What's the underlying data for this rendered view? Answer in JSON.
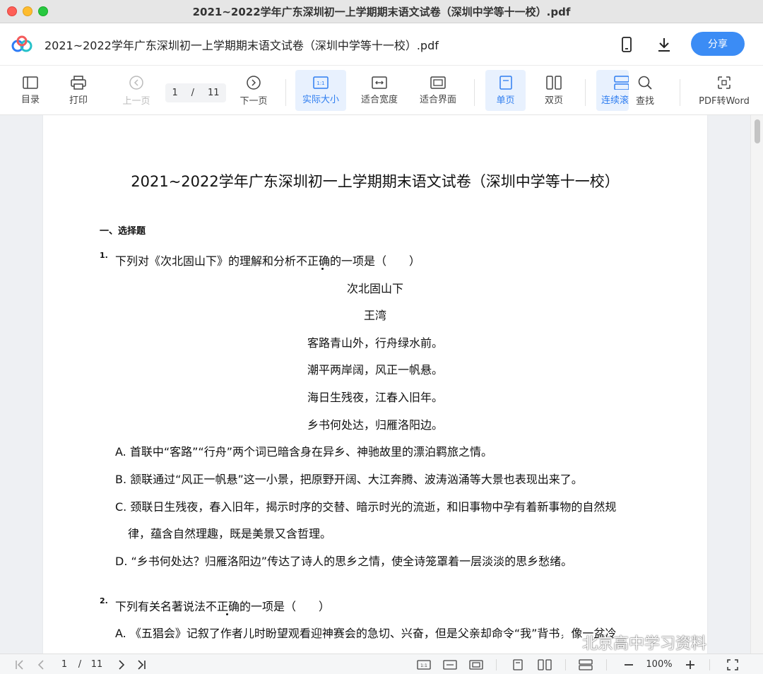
{
  "window": {
    "title": "2021~2022学年广东深圳初一上学期期末语文试卷（深圳中学等十一校）.pdf"
  },
  "header": {
    "doc_title": "2021~2022学年广东深圳初一上学期期末语文试卷（深圳中学等十一校）.pdf",
    "share_label": "分享",
    "icons": [
      "mobile-icon",
      "download-icon"
    ]
  },
  "toolbar": {
    "toc": "目录",
    "print": "打印",
    "prev": "上一页",
    "page_current": "1",
    "page_sep": "/",
    "page_total": "11",
    "next": "下一页",
    "actual_size": "实际大小",
    "fit_width": "适合宽度",
    "fit_window": "适合界面",
    "single": "单页",
    "double": "双页",
    "continuous": "连续滚",
    "find": "查找",
    "pdf_to_word": "PDF转Word"
  },
  "document": {
    "title": "2021~2022学年广东深圳初一上学期期末语文试卷（深圳中学等十一校）",
    "section": "一、选择题",
    "q1": {
      "num": "1.",
      "text": "下列对《次北固山下》的理解和分析不正确的一项是（　　）",
      "poem": [
        "次北固山下",
        "王湾",
        "客路青山外，行舟绿水前。",
        "潮平两岸阔，风正一帆悬。",
        "海日生残夜，江春入旧年。",
        "乡书何处达，归雁洛阳边。"
      ],
      "options": [
        "A. 首联中“客路”“行舟”两个词已暗含身在异乡、神驰故里的漂泊羁旅之情。",
        "B. 颔联通过“风正一帆悬”这一小景，把原野开阔、大江奔腾、波涛汹涌等大景也表现出来了。",
        "C. 颈联日生残夜，春入旧年，揭示时序的交替、暗示时光的流逝，和旧事物中孕有着新事物的自然规",
        "律，蕴含自然理趣，既是美景又含哲理。",
        "D. “乡书何处达？归雁洛阳边”传达了诗人的思乡之情，使全诗笼罩着一层淡淡的思乡愁绪。"
      ]
    },
    "q2": {
      "num": "2.",
      "text": "下列有关名著说法不正确的一项是（　　）",
      "options": [
        "A. 《五猖会》记叙了作者儿时盼望观看迎神赛会的急切、兴奋，但是父亲却命令“我”背书，像一盆冷"
      ]
    }
  },
  "watermark": "北京高中学习资料",
  "bottombar": {
    "page_current": "1",
    "page_sep": "/",
    "page_total": "11",
    "zoom": "100%"
  },
  "colors": {
    "accent": "#3b8cf5",
    "active_bg": "#e8f1fe",
    "active_text": "#2f7ef0"
  }
}
